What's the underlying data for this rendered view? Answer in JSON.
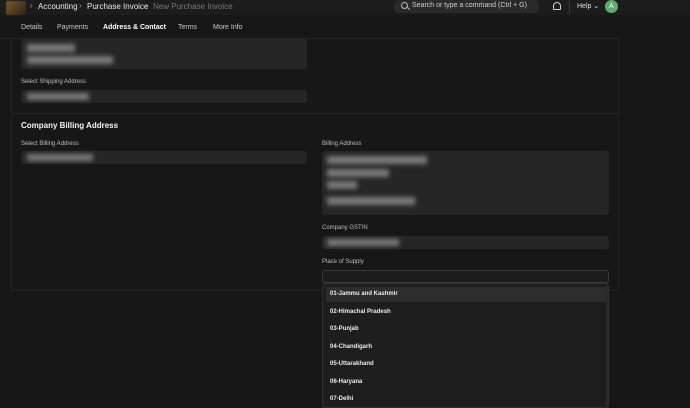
{
  "navbar": {
    "logo": "app-logo",
    "breadcrumbs": [
      "Accounting",
      "Purchase Invoice",
      "New Purchase Invoice"
    ],
    "search_placeholder": "Search or type a command (Ctrl + G)",
    "help_label": "Help",
    "avatar_initial": "A"
  },
  "tabs": [
    "Details",
    "Payments",
    "Address & Contact",
    "Terms",
    "More Info"
  ],
  "active_tab": "Address & Contact",
  "form": {
    "select_shipping_address_label": "Select Shipping Address",
    "company_billing_section_title": "Company Billing Address",
    "select_billing_address_label": "Select Billing Address",
    "billing_address_label": "Billing Address",
    "company_gstin_label": "Company GSTIN",
    "place_of_supply_label": "Place of Supply",
    "place_of_supply_value": ""
  },
  "dropdown": {
    "highlighted_index": 0,
    "options": [
      "01-Jammu and Kashmir",
      "02-Himachal Pradesh",
      "03-Punjab",
      "04-Chandigarh",
      "05-Uttarakhand",
      "06-Haryana",
      "07-Delhi"
    ]
  },
  "colors": {
    "background": "#171717",
    "field": "#262626",
    "avatar": "#5ab06a"
  }
}
